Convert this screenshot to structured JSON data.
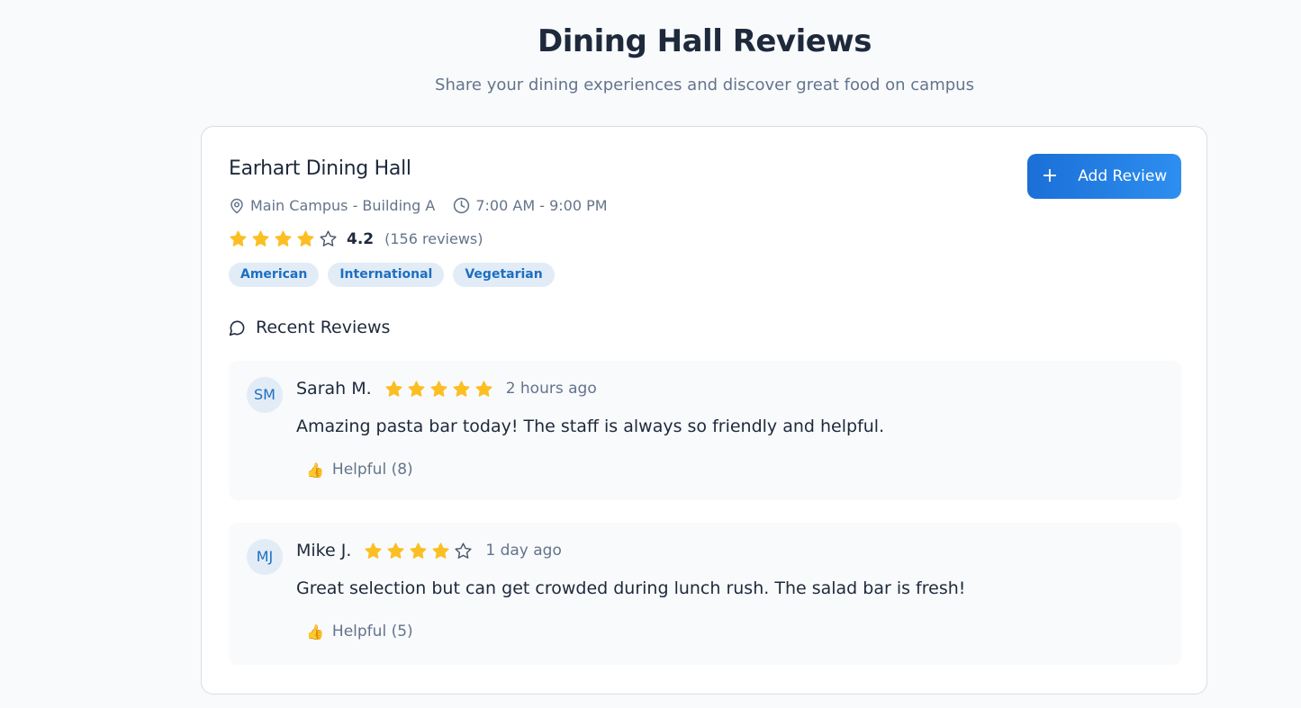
{
  "page": {
    "title": "Dining Hall Reviews",
    "subtitle": "Share your dining experiences and discover great food on campus"
  },
  "hall": {
    "name": "Earhart Dining Hall",
    "location": "Main Campus - Building A",
    "hours": "7:00 AM - 9:00 PM",
    "rating": "4.2",
    "rating_stars": 4,
    "review_count": "(156 reviews)",
    "tags": [
      "American",
      "International",
      "Vegetarian"
    ],
    "add_review_label": "Add Review"
  },
  "recent": {
    "heading": "Recent Reviews",
    "reviews": [
      {
        "initials": "SM",
        "name": "Sarah M.",
        "stars": 5,
        "time": "2 hours ago",
        "text": "Amazing pasta bar today! The staff is always so friendly and helpful.",
        "helpful": "Helpful (8)"
      },
      {
        "initials": "MJ",
        "name": "Mike J.",
        "stars": 4,
        "time": "1 day ago",
        "text": "Great selection but can get crowded during lunch rush. The salad bar is fresh!",
        "helpful": "Helpful (5)"
      }
    ]
  },
  "colors": {
    "accent": "#1b6fd6",
    "star_filled": "#fbbf24",
    "star_empty": "#475569",
    "tag_bg": "#e2ecf7",
    "tag_text": "#1d6fc1"
  },
  "icons": {
    "location": "map-pin-icon",
    "hours": "clock-icon",
    "recent": "chat-bubble-icon",
    "add": "plus-icon",
    "helpful": "thumbs-up-icon"
  }
}
